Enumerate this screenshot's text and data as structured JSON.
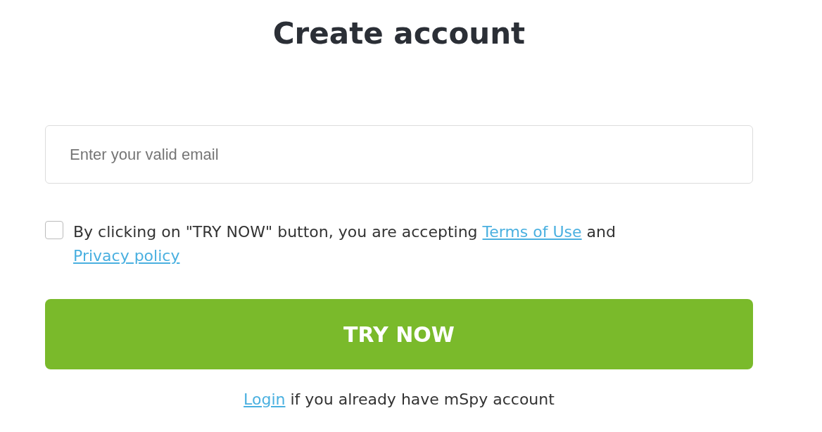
{
  "title": "Create account",
  "email_field": {
    "placeholder": "Enter your valid email"
  },
  "consent": {
    "checked": false,
    "text_before": "By clicking on \"TRY NOW\" button, you are accepting ",
    "terms_link": "Terms of Use",
    "middle": " and ",
    "privacy_link": "Privacy policy"
  },
  "submit_button": "TRY NOW",
  "login_line": {
    "link": "Login",
    "text": " if you already have mSpy account"
  }
}
